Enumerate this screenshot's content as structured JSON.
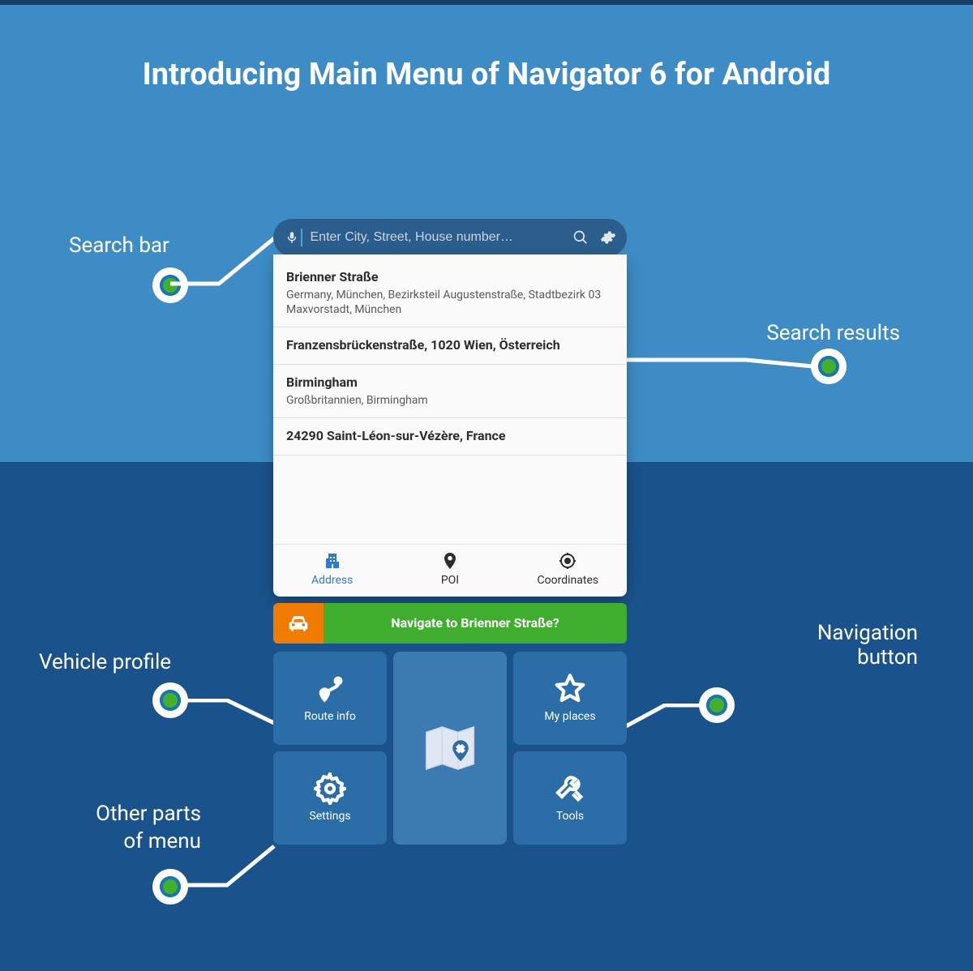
{
  "title": "Introducing Main Menu of Navigator 6 for Android",
  "callouts": {
    "search_bar": "Search bar",
    "search_results": "Search results",
    "vehicle_profile": "Vehicle profile",
    "navigation_button": "Navigation button",
    "other_menu_line1": "Other parts",
    "other_menu_line2": "of menu"
  },
  "search": {
    "placeholder": "Enter City, Street, House number…"
  },
  "results": [
    {
      "title": "Brienner Straße",
      "sub": "Germany, München, Bezirksteil Augustenstraße, Stadtbezirk 03 Maxvorstadt, München"
    },
    {
      "title": "Franzensbrückenstraße, 1020 Wien, Österreich",
      "sub": ""
    },
    {
      "title": "Birmingham",
      "sub": "Großbritannien, Birmingham"
    },
    {
      "title": "24290 Saint-Léon-sur-Vézère, France",
      "sub": ""
    }
  ],
  "tabs": {
    "address": "Address",
    "poi": "POI",
    "coordinates": "Coordinates"
  },
  "navigate": {
    "label": "Navigate to Brienner Straße?"
  },
  "menu": {
    "route_info": "Route info",
    "my_places": "My places",
    "settings": "Settings",
    "tools": "Tools"
  },
  "colors": {
    "bg_top": "#3d8cc6",
    "bg_bottom": "#1a538b",
    "search_bar_bg": "#2b5e8c",
    "accent_orange": "#ef7c00",
    "accent_green": "#3fad2e",
    "tile_bg": "#2b6da7",
    "active_tab": "#2d7bd1"
  }
}
